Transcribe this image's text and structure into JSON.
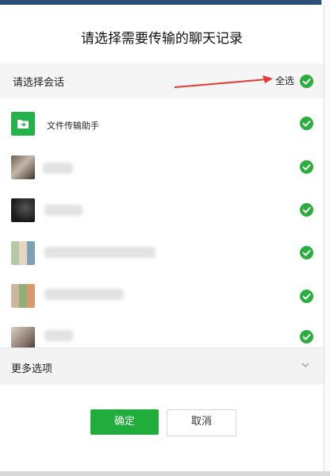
{
  "dialog": {
    "title": "请选择需要传输的聊天记录",
    "section_label": "请选择会话",
    "select_all_label": "全选",
    "more_options_label": "更多选项",
    "confirm_label": "确定",
    "cancel_label": "取消"
  },
  "conversations": [
    {
      "name": "文件传输助手",
      "avatar": "file-transfer-icon",
      "checked": true
    },
    {
      "name": "",
      "avatar": "blurred-photo",
      "checked": true
    },
    {
      "name": "",
      "avatar": "blurred-photo",
      "checked": true
    },
    {
      "name": "",
      "avatar": "group-grid",
      "checked": true
    },
    {
      "name": "",
      "avatar": "group-grid",
      "checked": true
    },
    {
      "name": "",
      "avatar": "blurred-photo",
      "checked": true
    }
  ],
  "colors": {
    "accent": "#2aae3e",
    "annotation_arrow": "#e53935"
  }
}
